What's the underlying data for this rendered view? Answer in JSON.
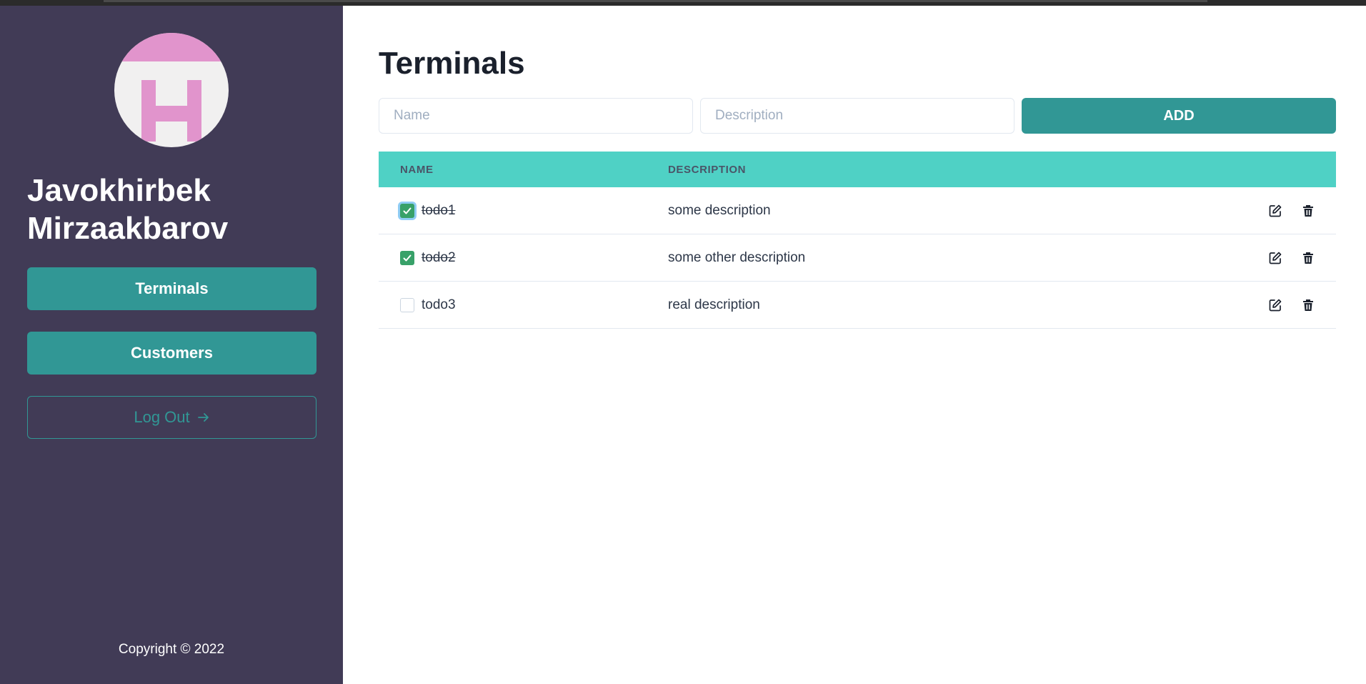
{
  "sidebar": {
    "avatar_letter": "H",
    "user_name_line1": "Javokhirbek",
    "user_name_line2": "Mirzaakbarov",
    "nav": {
      "terminals_label": "Terminals",
      "customers_label": "Customers"
    },
    "logout_label": "Log Out",
    "logout_icon": "arrow-right-icon",
    "copyright": "Copyright © 2022"
  },
  "main": {
    "title": "Terminals",
    "form": {
      "name_placeholder": "Name",
      "name_value": "",
      "description_placeholder": "Description",
      "description_value": "",
      "add_label": "ADD"
    },
    "table": {
      "headers": {
        "name": "NAME",
        "description": "DESCRIPTION"
      },
      "rows": [
        {
          "name": "todo1",
          "description": "some description",
          "done": true
        },
        {
          "name": "todo2",
          "description": "some other description",
          "done": true
        },
        {
          "name": "todo3",
          "description": "real description",
          "done": false
        }
      ],
      "row_actions": [
        "edit-icon",
        "trash-icon"
      ]
    }
  },
  "colors": {
    "sidebar_bg": "#413b56",
    "accent_teal": "#319795",
    "table_header_bg": "#4fd1c5",
    "checkbox_green": "#38a169",
    "avatar_pink": "#e194cc"
  }
}
